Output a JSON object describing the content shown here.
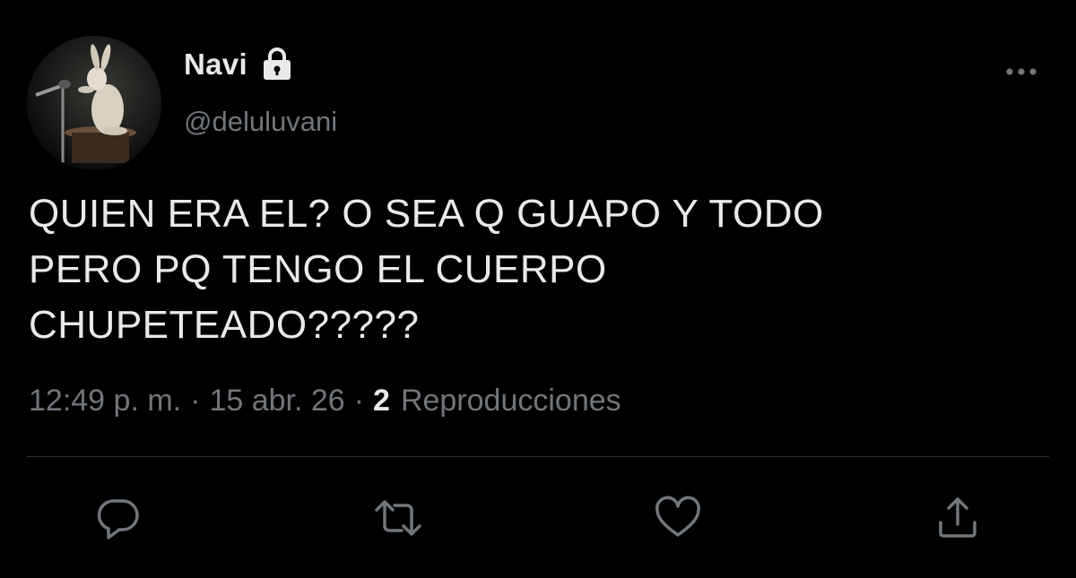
{
  "colors": {
    "background": "#000000",
    "primary_text": "#e7e9ea",
    "secondary_text": "#71767b",
    "divider": "#2f3336"
  },
  "author": {
    "display_name": "Navi",
    "handle": "@deluluvani",
    "protected_icon": "lock-icon",
    "avatar_icon": "avatar-image"
  },
  "tweet": {
    "text_lines": [
      "QUIEN ERA EL? O SEA Q GUAPO Y TODO",
      "PERO PQ TENGO EL CUERPO",
      "CHUPETEADO?????"
    ]
  },
  "meta": {
    "time": "12:49 p. m.",
    "separator": "·",
    "date": "15 abr. 26",
    "views_count": "2",
    "views_label": "Reproducciones"
  },
  "actions": [
    {
      "name": "reply",
      "icon": "reply-icon"
    },
    {
      "name": "retweet",
      "icon": "retweet-icon"
    },
    {
      "name": "like",
      "icon": "heart-icon"
    },
    {
      "name": "share",
      "icon": "share-icon"
    }
  ],
  "menu_icon": "more-options-icon"
}
